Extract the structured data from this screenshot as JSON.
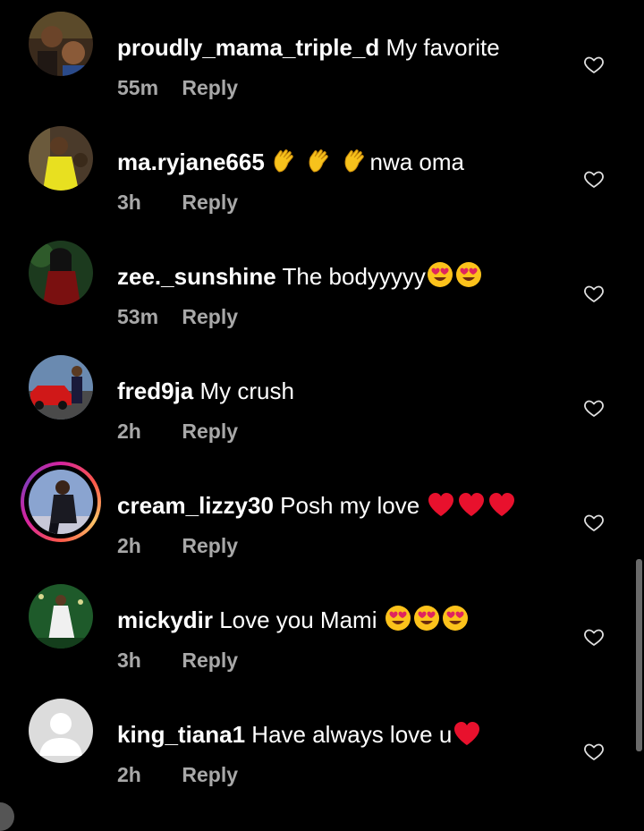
{
  "comments": [
    {
      "username": "proudly_mama_triple_d",
      "text": "My favorite",
      "time": "55m",
      "reply": "Reply",
      "avatar": "photo-avatar",
      "emojis": []
    },
    {
      "username": "ma.ryjane665",
      "text": "nwa oma",
      "time": "3h",
      "reply": "Reply",
      "avatar": "photo-avatar",
      "emojis": [
        "clapping-hands-emoji",
        "clapping-hands-emoji",
        "clapping-hands-emoji"
      ]
    },
    {
      "username": "zee._sunshine",
      "text": "The bodyyyyy",
      "time": "53m",
      "reply": "Reply",
      "avatar": "photo-avatar",
      "emojis": [
        "heart-eyes-emoji",
        "heart-eyes-emoji"
      ]
    },
    {
      "username": "fred9ja",
      "text": "My crush",
      "time": "2h",
      "reply": "Reply",
      "avatar": "photo-avatar",
      "emojis": []
    },
    {
      "username": "cream_lizzy30",
      "text": "Posh my love",
      "time": "2h",
      "reply": "Reply",
      "avatar": "photo-avatar-story-ring",
      "emojis": [
        "red-heart-emoji",
        "red-heart-emoji",
        "red-heart-emoji"
      ]
    },
    {
      "username": "mickydir",
      "text": "Love you Mami",
      "time": "3h",
      "reply": "Reply",
      "avatar": "photo-avatar",
      "emojis": [
        "heart-eyes-emoji",
        "heart-eyes-emoji",
        "heart-eyes-emoji"
      ]
    },
    {
      "username": "king_tiana1",
      "text": "Have always love u",
      "time": "2h",
      "reply": "Reply",
      "avatar": "default-avatar",
      "emojis": [
        "red-heart-emoji"
      ]
    }
  ],
  "like_icon": "heart-outline-icon",
  "colors": {
    "background": "#000000",
    "primary_text": "#ffffff",
    "secondary_text": "#a8a8a8",
    "story_ring": "#fd5949"
  }
}
